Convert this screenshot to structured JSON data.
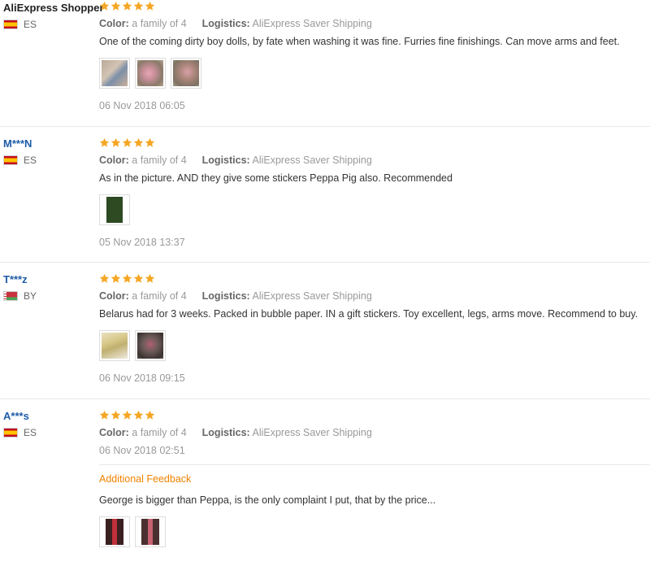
{
  "labels": {
    "color": "Color:",
    "logistics": "Logistics:",
    "additional_feedback": "Additional Feedback"
  },
  "colors": {
    "star": "#f5a623",
    "username": "#1d5ca8",
    "additional_title": "#f08200"
  },
  "reviews": [
    {
      "user": "AliExpress Shopper",
      "country_code": "ES",
      "flag_icon": "spain-flag-icon",
      "rating": 5,
      "color": "a family of 4",
      "logistics": "AliExpress Saver Shipping",
      "text": "One of the coming dirty boy dolls, by fate when washing it was fine. Furries fine finishings. Can move arms and feet.",
      "photo_count": 3,
      "date": "06 Nov 2018 06:05"
    },
    {
      "user": "M***N",
      "country_code": "ES",
      "flag_icon": "spain-flag-icon",
      "rating": 5,
      "color": "a family of 4",
      "logistics": "AliExpress Saver Shipping",
      "text": "As in the picture. AND they give some stickers Peppa Pig also. Recommended",
      "photo_count": 1,
      "date": "05 Nov 2018 13:37"
    },
    {
      "user": "T***z",
      "country_code": "BY",
      "flag_icon": "belarus-flag-icon",
      "rating": 5,
      "color": "a family of 4",
      "logistics": "AliExpress Saver Shipping",
      "text": "Belarus had for 3 weeks. Packed in bubble paper. IN a gift stickers. Toy excellent, legs, arms move. Recommend to buy.",
      "photo_count": 2,
      "date": "06 Nov 2018 09:15"
    },
    {
      "user": "A***s",
      "country_code": "ES",
      "flag_icon": "spain-flag-icon",
      "rating": 5,
      "color": "a family of 4",
      "logistics": "AliExpress Saver Shipping",
      "date": "06 Nov 2018 02:51",
      "additional_text": "George is bigger than Peppa, is the only complaint I put, that by the price...",
      "additional_photo_count": 2
    }
  ]
}
